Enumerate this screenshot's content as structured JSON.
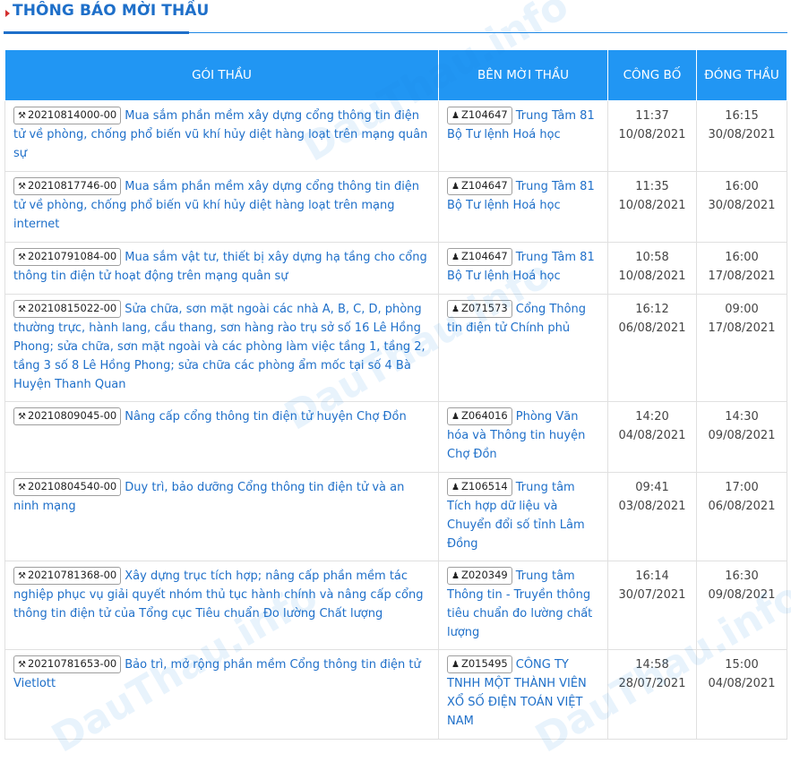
{
  "section": {
    "title": "THÔNG BÁO MỜI THẦU"
  },
  "table": {
    "headers": {
      "package": "GÓI THẦU",
      "inviter": "BÊN MỜI THẦU",
      "published": "CÔNG BỐ",
      "closing": "ĐÓNG THẦU"
    },
    "rows": [
      {
        "code": "20210814000-00",
        "title": "Mua sắm phần mềm xây dựng cổng thông tin điện tử về phòng, chống phổ biến vũ khí hủy diệt hàng loạt trên mạng quân sự",
        "inviter_code": "Z104647",
        "inviter": "Trung Tâm 81 Bộ Tư lệnh Hoá học",
        "pub_time": "11:37",
        "pub_date": "10/08/2021",
        "close_time": "16:15",
        "close_date": "30/08/2021"
      },
      {
        "code": "20210817746-00",
        "title": "Mua sắm phần mềm xây dựng cổng thông tin điện tử về phòng, chống phổ biến vũ khí hủy diệt hàng loạt trên mạng internet",
        "inviter_code": "Z104647",
        "inviter": "Trung Tâm 81 Bộ Tư lệnh Hoá học",
        "pub_time": "11:35",
        "pub_date": "10/08/2021",
        "close_time": "16:00",
        "close_date": "30/08/2021"
      },
      {
        "code": "20210791084-00",
        "title": "Mua sắm vật tư, thiết bị xây dựng hạ tầng cho cổng thông tin điện tử hoạt động trên mạng quân sự",
        "inviter_code": "Z104647",
        "inviter": "Trung Tâm 81 Bộ Tư lệnh Hoá học",
        "pub_time": "10:58",
        "pub_date": "10/08/2021",
        "close_time": "16:00",
        "close_date": "17/08/2021"
      },
      {
        "code": "20210815022-00",
        "title": "Sửa chữa, sơn mặt ngoài các nhà A, B, C, D, phòng thường trực, hành lang, cầu thang, sơn hàng rào trụ sở số 16 Lê Hồng Phong; sửa chữa, sơn mặt ngoài và các phòng làm việc tầng 1, tầng 2, tầng 3 số 8 Lê Hồng Phong; sửa chữa các phòng ẩm mốc tại số 4 Bà Huyện Thanh Quan",
        "inviter_code": "Z071573",
        "inviter": "Cổng Thông tin điện tử Chính phủ",
        "pub_time": "16:12",
        "pub_date": "06/08/2021",
        "close_time": "09:00",
        "close_date": "17/08/2021"
      },
      {
        "code": "20210809045-00",
        "title": "Nâng cấp cổng thông tin điện tử huyện Chợ Đồn",
        "inviter_code": "Z064016",
        "inviter": "Phòng Văn hóa và Thông tin huyện Chợ Đồn",
        "pub_time": "14:20",
        "pub_date": "04/08/2021",
        "close_time": "14:30",
        "close_date": "09/08/2021"
      },
      {
        "code": "20210804540-00",
        "title": "Duy trì, bảo dưỡng Cổng thông tin điện tử và an ninh mạng",
        "inviter_code": "Z106514",
        "inviter": "Trung tâm Tích hợp dữ liệu và Chuyển đổi số tỉnh Lâm Đồng",
        "pub_time": "09:41",
        "pub_date": "03/08/2021",
        "close_time": "17:00",
        "close_date": "06/08/2021"
      },
      {
        "code": "20210781368-00",
        "title": "Xây dựng trục tích hợp; nâng cấp phần mềm tác nghiệp phục vụ giải quyết nhóm thủ tục hành chính và nâng cấp cổng thông tin điện tử của Tổng cục Tiêu chuẩn Đo lường Chất lượng",
        "inviter_code": "Z020349",
        "inviter": "Trung tâm Thông tin - Truyền thông tiêu chuẩn đo lường chất lượng",
        "pub_time": "16:14",
        "pub_date": "30/07/2021",
        "close_time": "16:30",
        "close_date": "09/08/2021"
      },
      {
        "code": "20210781653-00",
        "title": "Bảo trì, mở rộng phần mềm Cổng thông tin điện tử Vietlott",
        "inviter_code": "Z015495",
        "inviter": "CÔNG TY TNHH MỘT THÀNH VIÊN XỔ SỐ ĐIỆN TOÁN VIỆT NAM",
        "pub_time": "14:58",
        "pub_date": "28/07/2021",
        "close_time": "15:00",
        "close_date": "04/08/2021"
      }
    ]
  },
  "icons": {
    "code_icon": "hammer-icon",
    "inviter_icon": "users-icon"
  },
  "colors": {
    "accent": "#1e6fc9",
    "header_bg": "#2196f3",
    "marker": "#d32f2f"
  }
}
